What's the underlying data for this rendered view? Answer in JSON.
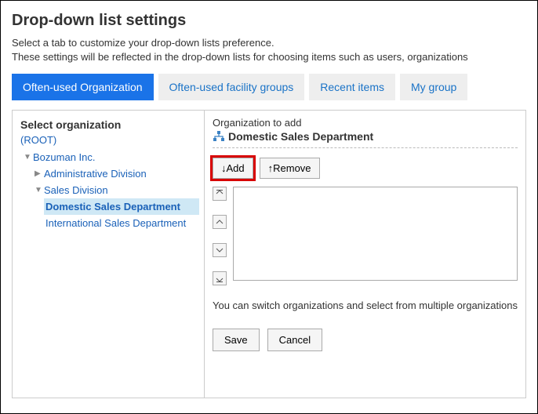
{
  "title": "Drop-down list settings",
  "description_line1": "Select a tab to customize your drop-down lists preference.",
  "description_line2": "These settings will be reflected in the drop-down lists for choosing items such as users, organizations",
  "tabs": [
    {
      "label": "Often-used Organization",
      "active": true
    },
    {
      "label": "Often-used facility groups",
      "active": false
    },
    {
      "label": "Recent items",
      "active": false
    },
    {
      "label": "My group",
      "active": false
    }
  ],
  "left": {
    "title": "Select organization",
    "root": "(ROOT)",
    "tree": {
      "l1": "Bozuman Inc.",
      "l2a": "Administrative Division",
      "l2b": "Sales Division",
      "l3a": "Domestic Sales Department",
      "l3b": "International Sales Department"
    }
  },
  "right": {
    "add_label": "Organization to add",
    "selected_org": "Domestic Sales Department",
    "add_button": "↓Add",
    "remove_button": "↑Remove",
    "switch_text": "You can switch organizations and select from multiple organizations",
    "save": "Save",
    "cancel": "Cancel"
  }
}
